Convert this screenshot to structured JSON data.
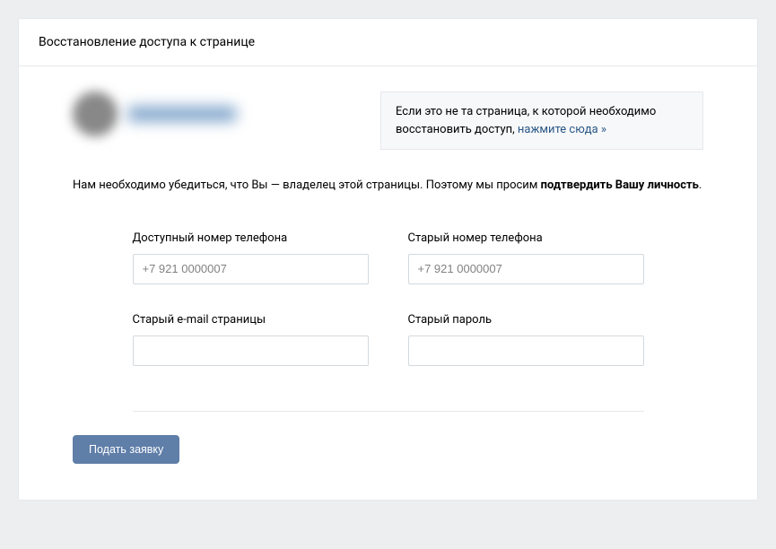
{
  "header": {
    "title": "Восстановление доступа к странице"
  },
  "notice": {
    "text_before": "Если это не та страница, к которой необходимо восстановить доступ, ",
    "link_text": "нажмите сюда »"
  },
  "description": {
    "text_before": "Нам необходимо убедиться, что Вы — владелец этой страницы. Поэтому мы просим ",
    "bold": "подтвердить Вашу личность",
    "text_after": "."
  },
  "form": {
    "available_phone": {
      "label": "Доступный номер телефона",
      "placeholder": "+7 921 0000007",
      "value": ""
    },
    "old_phone": {
      "label": "Старый номер телефона",
      "placeholder": "+7 921 0000007",
      "value": ""
    },
    "old_email": {
      "label": "Старый e-mail страницы",
      "placeholder": "",
      "value": ""
    },
    "old_password": {
      "label": "Старый пароль",
      "placeholder": "",
      "value": ""
    },
    "submit": "Подать заявку"
  }
}
